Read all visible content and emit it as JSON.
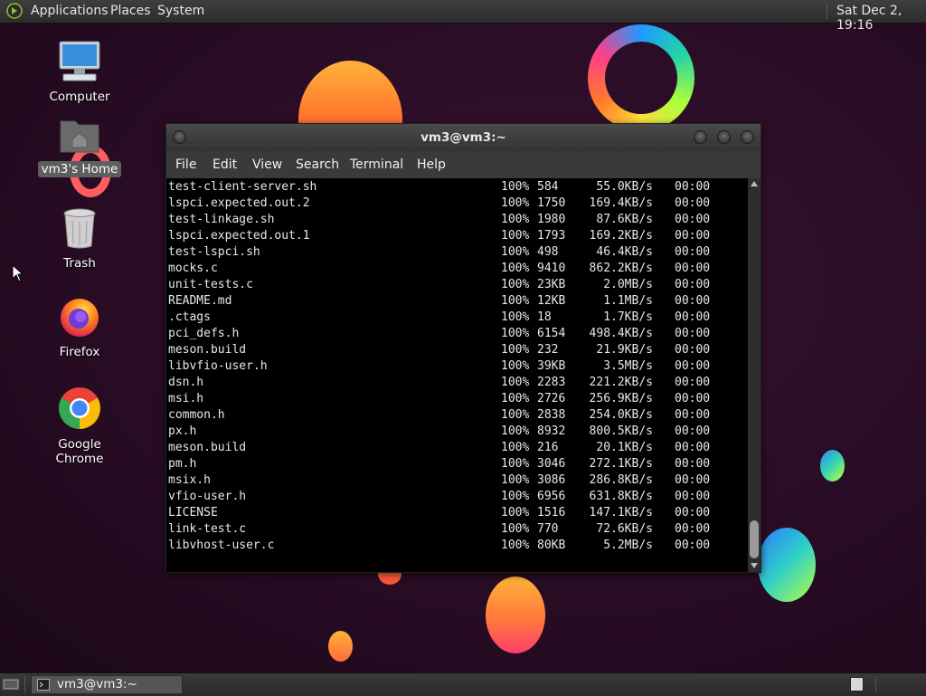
{
  "top_panel": {
    "menus": [
      "Applications",
      "Places",
      "System"
    ],
    "clock": "Sat Dec  2, 19:16"
  },
  "desktop_icons": [
    {
      "label": "Computer",
      "icon": "computer-icon"
    },
    {
      "label": "vm3's Home",
      "icon": "home-folder-icon",
      "selected": true
    },
    {
      "label": "Trash",
      "icon": "trash-icon"
    },
    {
      "label": "Firefox",
      "icon": "firefox-icon"
    },
    {
      "label": "Google Chrome",
      "icon": "chrome-icon"
    }
  ],
  "terminal": {
    "title": "vm3@vm3:~",
    "menu": [
      "File",
      "Edit",
      "View",
      "Search",
      "Terminal",
      "Help"
    ],
    "rows": [
      {
        "name": "test-client-server.sh",
        "pct": "100%",
        "size": "584",
        "rate": "55.0KB/s",
        "time": "00:00"
      },
      {
        "name": "lspci.expected.out.2",
        "pct": "100%",
        "size": "1750",
        "rate": "169.4KB/s",
        "time": "00:00"
      },
      {
        "name": "test-linkage.sh",
        "pct": "100%",
        "size": "1980",
        "rate": "87.6KB/s",
        "time": "00:00"
      },
      {
        "name": "lspci.expected.out.1",
        "pct": "100%",
        "size": "1793",
        "rate": "169.2KB/s",
        "time": "00:00"
      },
      {
        "name": "test-lspci.sh",
        "pct": "100%",
        "size": "498",
        "rate": "46.4KB/s",
        "time": "00:00"
      },
      {
        "name": "mocks.c",
        "pct": "100%",
        "size": "9410",
        "rate": "862.2KB/s",
        "time": "00:00"
      },
      {
        "name": "unit-tests.c",
        "pct": "100%",
        "size": "23KB",
        "rate": "2.0MB/s",
        "time": "00:00"
      },
      {
        "name": "README.md",
        "pct": "100%",
        "size": "12KB",
        "rate": "1.1MB/s",
        "time": "00:00"
      },
      {
        "name": ".ctags",
        "pct": "100%",
        "size": "18",
        "rate": "1.7KB/s",
        "time": "00:00"
      },
      {
        "name": "pci_defs.h",
        "pct": "100%",
        "size": "6154",
        "rate": "498.4KB/s",
        "time": "00:00"
      },
      {
        "name": "meson.build",
        "pct": "100%",
        "size": "232",
        "rate": "21.9KB/s",
        "time": "00:00"
      },
      {
        "name": "libvfio-user.h",
        "pct": "100%",
        "size": "39KB",
        "rate": "3.5MB/s",
        "time": "00:00"
      },
      {
        "name": "dsn.h",
        "pct": "100%",
        "size": "2283",
        "rate": "221.2KB/s",
        "time": "00:00"
      },
      {
        "name": "msi.h",
        "pct": "100%",
        "size": "2726",
        "rate": "256.9KB/s",
        "time": "00:00"
      },
      {
        "name": "common.h",
        "pct": "100%",
        "size": "2838",
        "rate": "254.0KB/s",
        "time": "00:00"
      },
      {
        "name": "px.h",
        "pct": "100%",
        "size": "8932",
        "rate": "800.5KB/s",
        "time": "00:00"
      },
      {
        "name": "meson.build",
        "pct": "100%",
        "size": "216",
        "rate": "20.1KB/s",
        "time": "00:00"
      },
      {
        "name": "pm.h",
        "pct": "100%",
        "size": "3046",
        "rate": "272.1KB/s",
        "time": "00:00"
      },
      {
        "name": "msix.h",
        "pct": "100%",
        "size": "3086",
        "rate": "286.8KB/s",
        "time": "00:00"
      },
      {
        "name": "vfio-user.h",
        "pct": "100%",
        "size": "6956",
        "rate": "631.8KB/s",
        "time": "00:00"
      },
      {
        "name": "LICENSE",
        "pct": "100%",
        "size": "1516",
        "rate": "147.1KB/s",
        "time": "00:00"
      },
      {
        "name": "link-test.c",
        "pct": "100%",
        "size": "770",
        "rate": "72.6KB/s",
        "time": "00:00"
      },
      {
        "name": "libvhost-user.c",
        "pct": "100%",
        "size": "80KB",
        "rate": "5.2MB/s",
        "time": "00:00"
      }
    ]
  },
  "bottom_panel": {
    "task_label": "vm3@vm3:~"
  }
}
